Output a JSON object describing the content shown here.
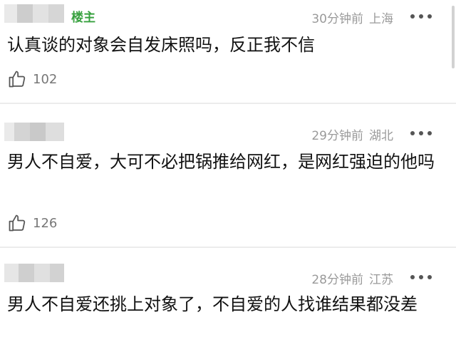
{
  "comments": [
    {
      "badge": "楼主",
      "time": "30分钟前",
      "location": "上海",
      "text": "认真谈的对象会自发床照吗，反正我不信",
      "likes": "102"
    },
    {
      "badge": "",
      "time": "29分钟前",
      "location": "湖北",
      "text": "男人不自爱，大可不必把锅推给网红，是网红强迫的他吗",
      "likes": "126"
    },
    {
      "badge": "",
      "time": "28分钟前",
      "location": "江苏",
      "text": "男人不自爱还挑上对象了，不自爱的人找谁结果都没差",
      "likes": ""
    }
  ],
  "icons": {
    "like": "thumbs-up-icon",
    "more": "more-dots-icon"
  },
  "colors": {
    "badge": "#37a13f",
    "meta": "#9a9a9a",
    "text": "#111111",
    "divider": "#ececec"
  }
}
